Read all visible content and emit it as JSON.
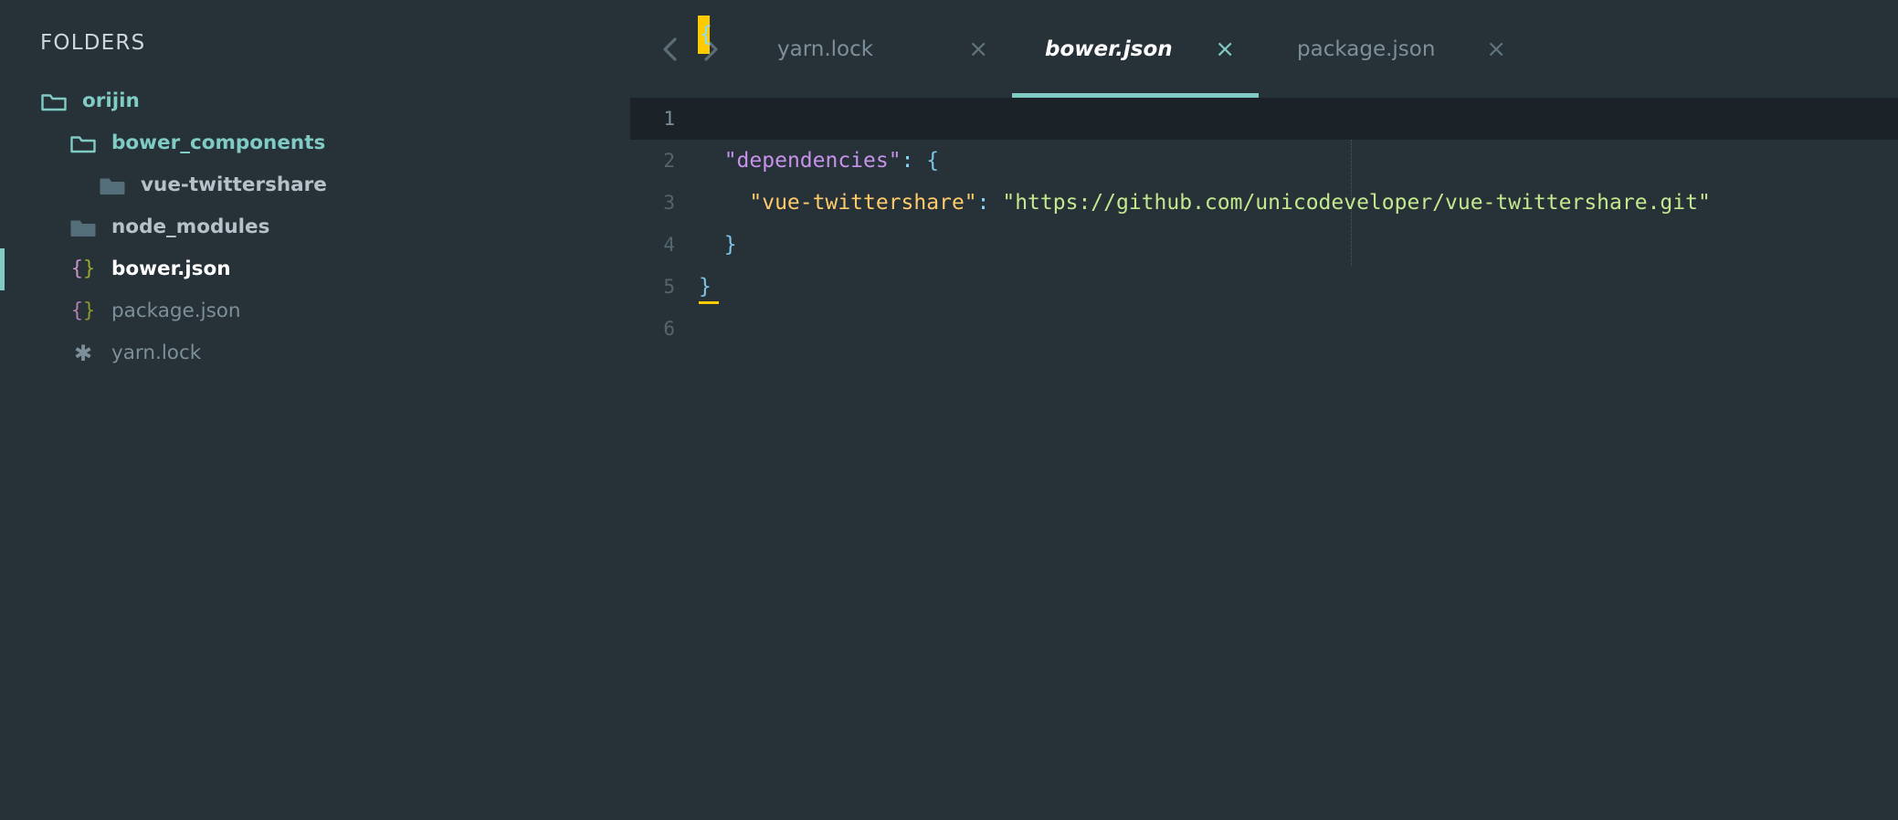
{
  "theme": {
    "background": "#263238",
    "accent_teal": "#80cbc4",
    "line_highlight": "#1b2228",
    "cursor": "#ffcb00",
    "muted_text": "#7d8f99"
  },
  "sidebar": {
    "header": "FOLDERS",
    "items": [
      {
        "label": "orijin",
        "type": "folder-open",
        "depth": 0,
        "icon": "folder-open-icon",
        "selected": false
      },
      {
        "label": "bower_components",
        "type": "folder-open",
        "depth": 1,
        "icon": "folder-open-icon",
        "selected": false
      },
      {
        "label": "vue-twittershare",
        "type": "folder-closed",
        "depth": 2,
        "icon": "folder-closed-icon",
        "selected": false
      },
      {
        "label": "node_modules",
        "type": "folder-closed",
        "depth": 1,
        "icon": "folder-closed-icon",
        "selected": false
      },
      {
        "label": "bower.json",
        "type": "file-json",
        "depth": 1,
        "icon": "json-file-icon",
        "selected": true
      },
      {
        "label": "package.json",
        "type": "file-json",
        "depth": 1,
        "icon": "json-file-icon",
        "selected": false
      },
      {
        "label": "yarn.lock",
        "type": "file-lock",
        "depth": 1,
        "icon": "asterisk-file-icon",
        "selected": false
      }
    ]
  },
  "tabbar": {
    "nav_prev_icon": "chevron-left-icon",
    "nav_next_icon": "chevron-right-icon",
    "close_glyph": "×",
    "tabs": [
      {
        "label": "yarn.lock",
        "active": false
      },
      {
        "label": "bower.json",
        "active": true
      },
      {
        "label": "package.json",
        "active": false
      }
    ]
  },
  "editor": {
    "filename": "bower.json",
    "language": "json",
    "cursor_line": 1,
    "cursor_column": 1,
    "line_numbers": [
      "1",
      "2",
      "3",
      "4",
      "5",
      "6"
    ],
    "lines": [
      {
        "n": "1",
        "text": "{"
      },
      {
        "n": "2",
        "text": "  \"dependencies\": {"
      },
      {
        "n": "3",
        "text": "    \"vue-twittershare\": \"https://github.com/unicodeveloper/vue-twittershare.git\""
      },
      {
        "n": "4",
        "text": "  }"
      },
      {
        "n": "5",
        "text": "}"
      },
      {
        "n": "6",
        "text": ""
      }
    ],
    "tokens": {
      "line2_key": "\"dependencies\"",
      "line2_colon": ":",
      "line2_brace": "{",
      "line3_key": "\"vue-twittershare\"",
      "line3_colon": ":",
      "line3_value": "\"https://github.com/unicodeveloper/vue-twittershare.git\"",
      "line4_brace": "}",
      "line5_brace": "}",
      "line1_brace": "{"
    }
  }
}
